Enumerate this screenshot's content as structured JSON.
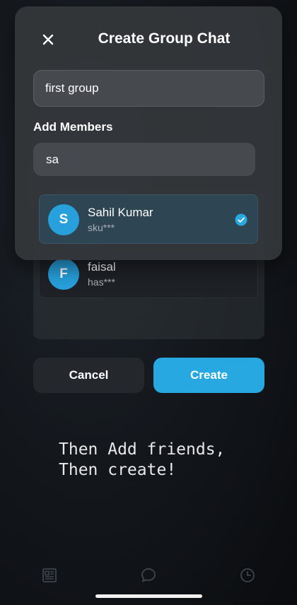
{
  "modal": {
    "title": "Create Group Chat",
    "close_icon": "close-icon",
    "group_name_value": "first group",
    "add_members_label": "Add Members",
    "search_value": "sa"
  },
  "members": [
    {
      "initial": "S",
      "name": "Sahil Kumar",
      "handle": "sku***",
      "selected": true
    },
    {
      "initial": "F",
      "name": "faisal",
      "handle": "has***",
      "selected": false
    }
  ],
  "buttons": {
    "cancel_label": "Cancel",
    "create_label": "Create"
  },
  "hint_text": "Then Add  friends,\nThen create!",
  "bottom_nav": {
    "items": [
      "newspaper-icon",
      "chat-bubble-icon",
      "clock-icon"
    ]
  },
  "colors": {
    "accent": "#27a8e0",
    "avatar": "#27a0dc",
    "modal_bg": "#34373b",
    "selected_row": "#2e4554"
  }
}
